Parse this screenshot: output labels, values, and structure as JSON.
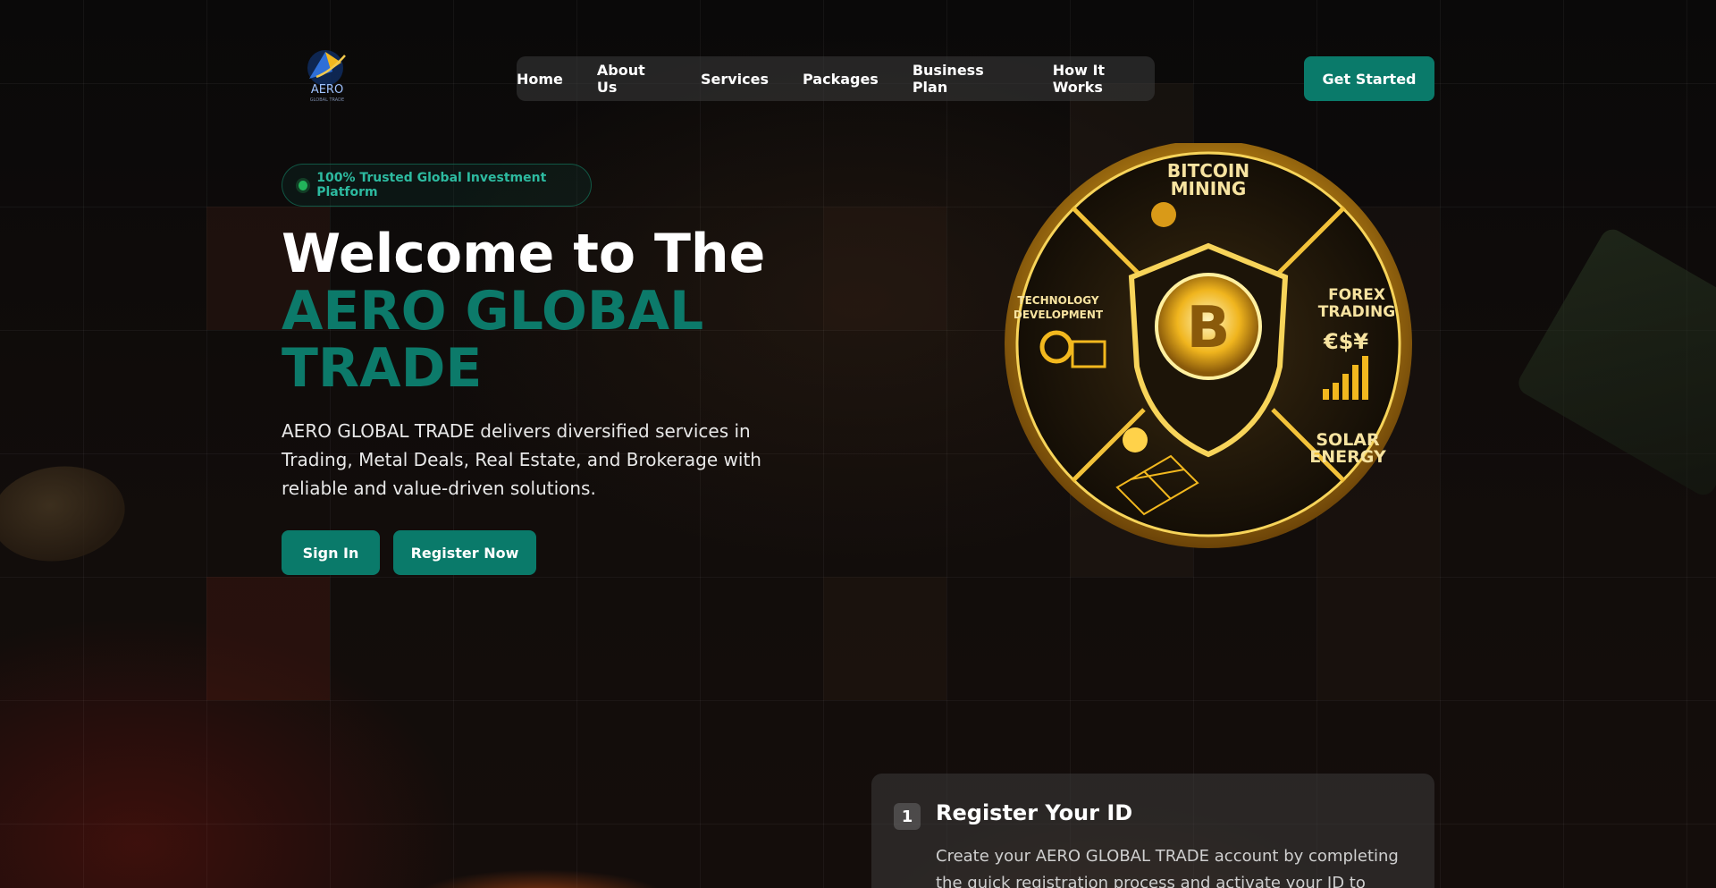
{
  "brand": {
    "logo_text": "AERO",
    "logo_subtext": "GLOBAL TRADE",
    "logo_icon": "aero-logo-icon"
  },
  "nav": {
    "items": [
      {
        "label": "Home"
      },
      {
        "label": "About Us"
      },
      {
        "label": "Services"
      },
      {
        "label": "Packages"
      },
      {
        "label": "Business Plan"
      },
      {
        "label": "How It Works"
      }
    ],
    "cta_label": "Get Started"
  },
  "hero": {
    "badge_text": "100% Trusted Global Investment Platform",
    "title_line1": "Welcome to The",
    "title_line2": "AERO GLOBAL TRADE",
    "description": "AERO GLOBAL TRADE delivers diversified services in Trading, Metal Deals, Real Estate, and Brokerage with reliable and value-driven solutions.",
    "sign_in_label": "Sign In",
    "register_label": "Register Now"
  },
  "emblem": {
    "center_icon": "bitcoin-icon",
    "segments": [
      {
        "label_top": "BITCOIN",
        "label_bottom": "MINING"
      },
      {
        "label_top": "FOREX",
        "label_bottom": "TRADING"
      },
      {
        "label_top": "SOLAR",
        "label_bottom": "ENERGY"
      },
      {
        "label_top": "TECHNOLOGY",
        "label_bottom": "DEVELOPMENT"
      }
    ],
    "currency_glyphs": "€$¥",
    "center_letter": "B"
  },
  "steps": [
    {
      "number": "1",
      "title": "Register Your ID",
      "text": "Create your AERO GLOBAL TRADE account by completing the quick registration process and activate your ID to access our"
    }
  ],
  "colors": {
    "accent": "#0a7a6a",
    "accent_text": "#0c7a6a",
    "badge_text": "#2dbaa0",
    "gold": "#f2b81e"
  }
}
